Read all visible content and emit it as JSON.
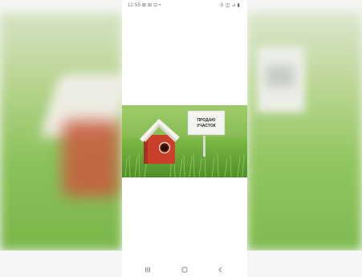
{
  "status_bar": {
    "left_text": "12:55 ⊠ ⊞ ⊡ •",
    "right_text": "⚲ ◫ ⊿ ▮"
  },
  "photo": {
    "sign_line1": "ПРОДАЮ",
    "sign_line2": "УЧАСТОК"
  },
  "nav": {
    "recent_icon": "recent-apps-icon",
    "home_icon": "home-icon",
    "back_icon": "back-icon"
  },
  "colors": {
    "grass": "#7bb344",
    "house": "#c9412b",
    "roof": "#f5f3ee"
  }
}
